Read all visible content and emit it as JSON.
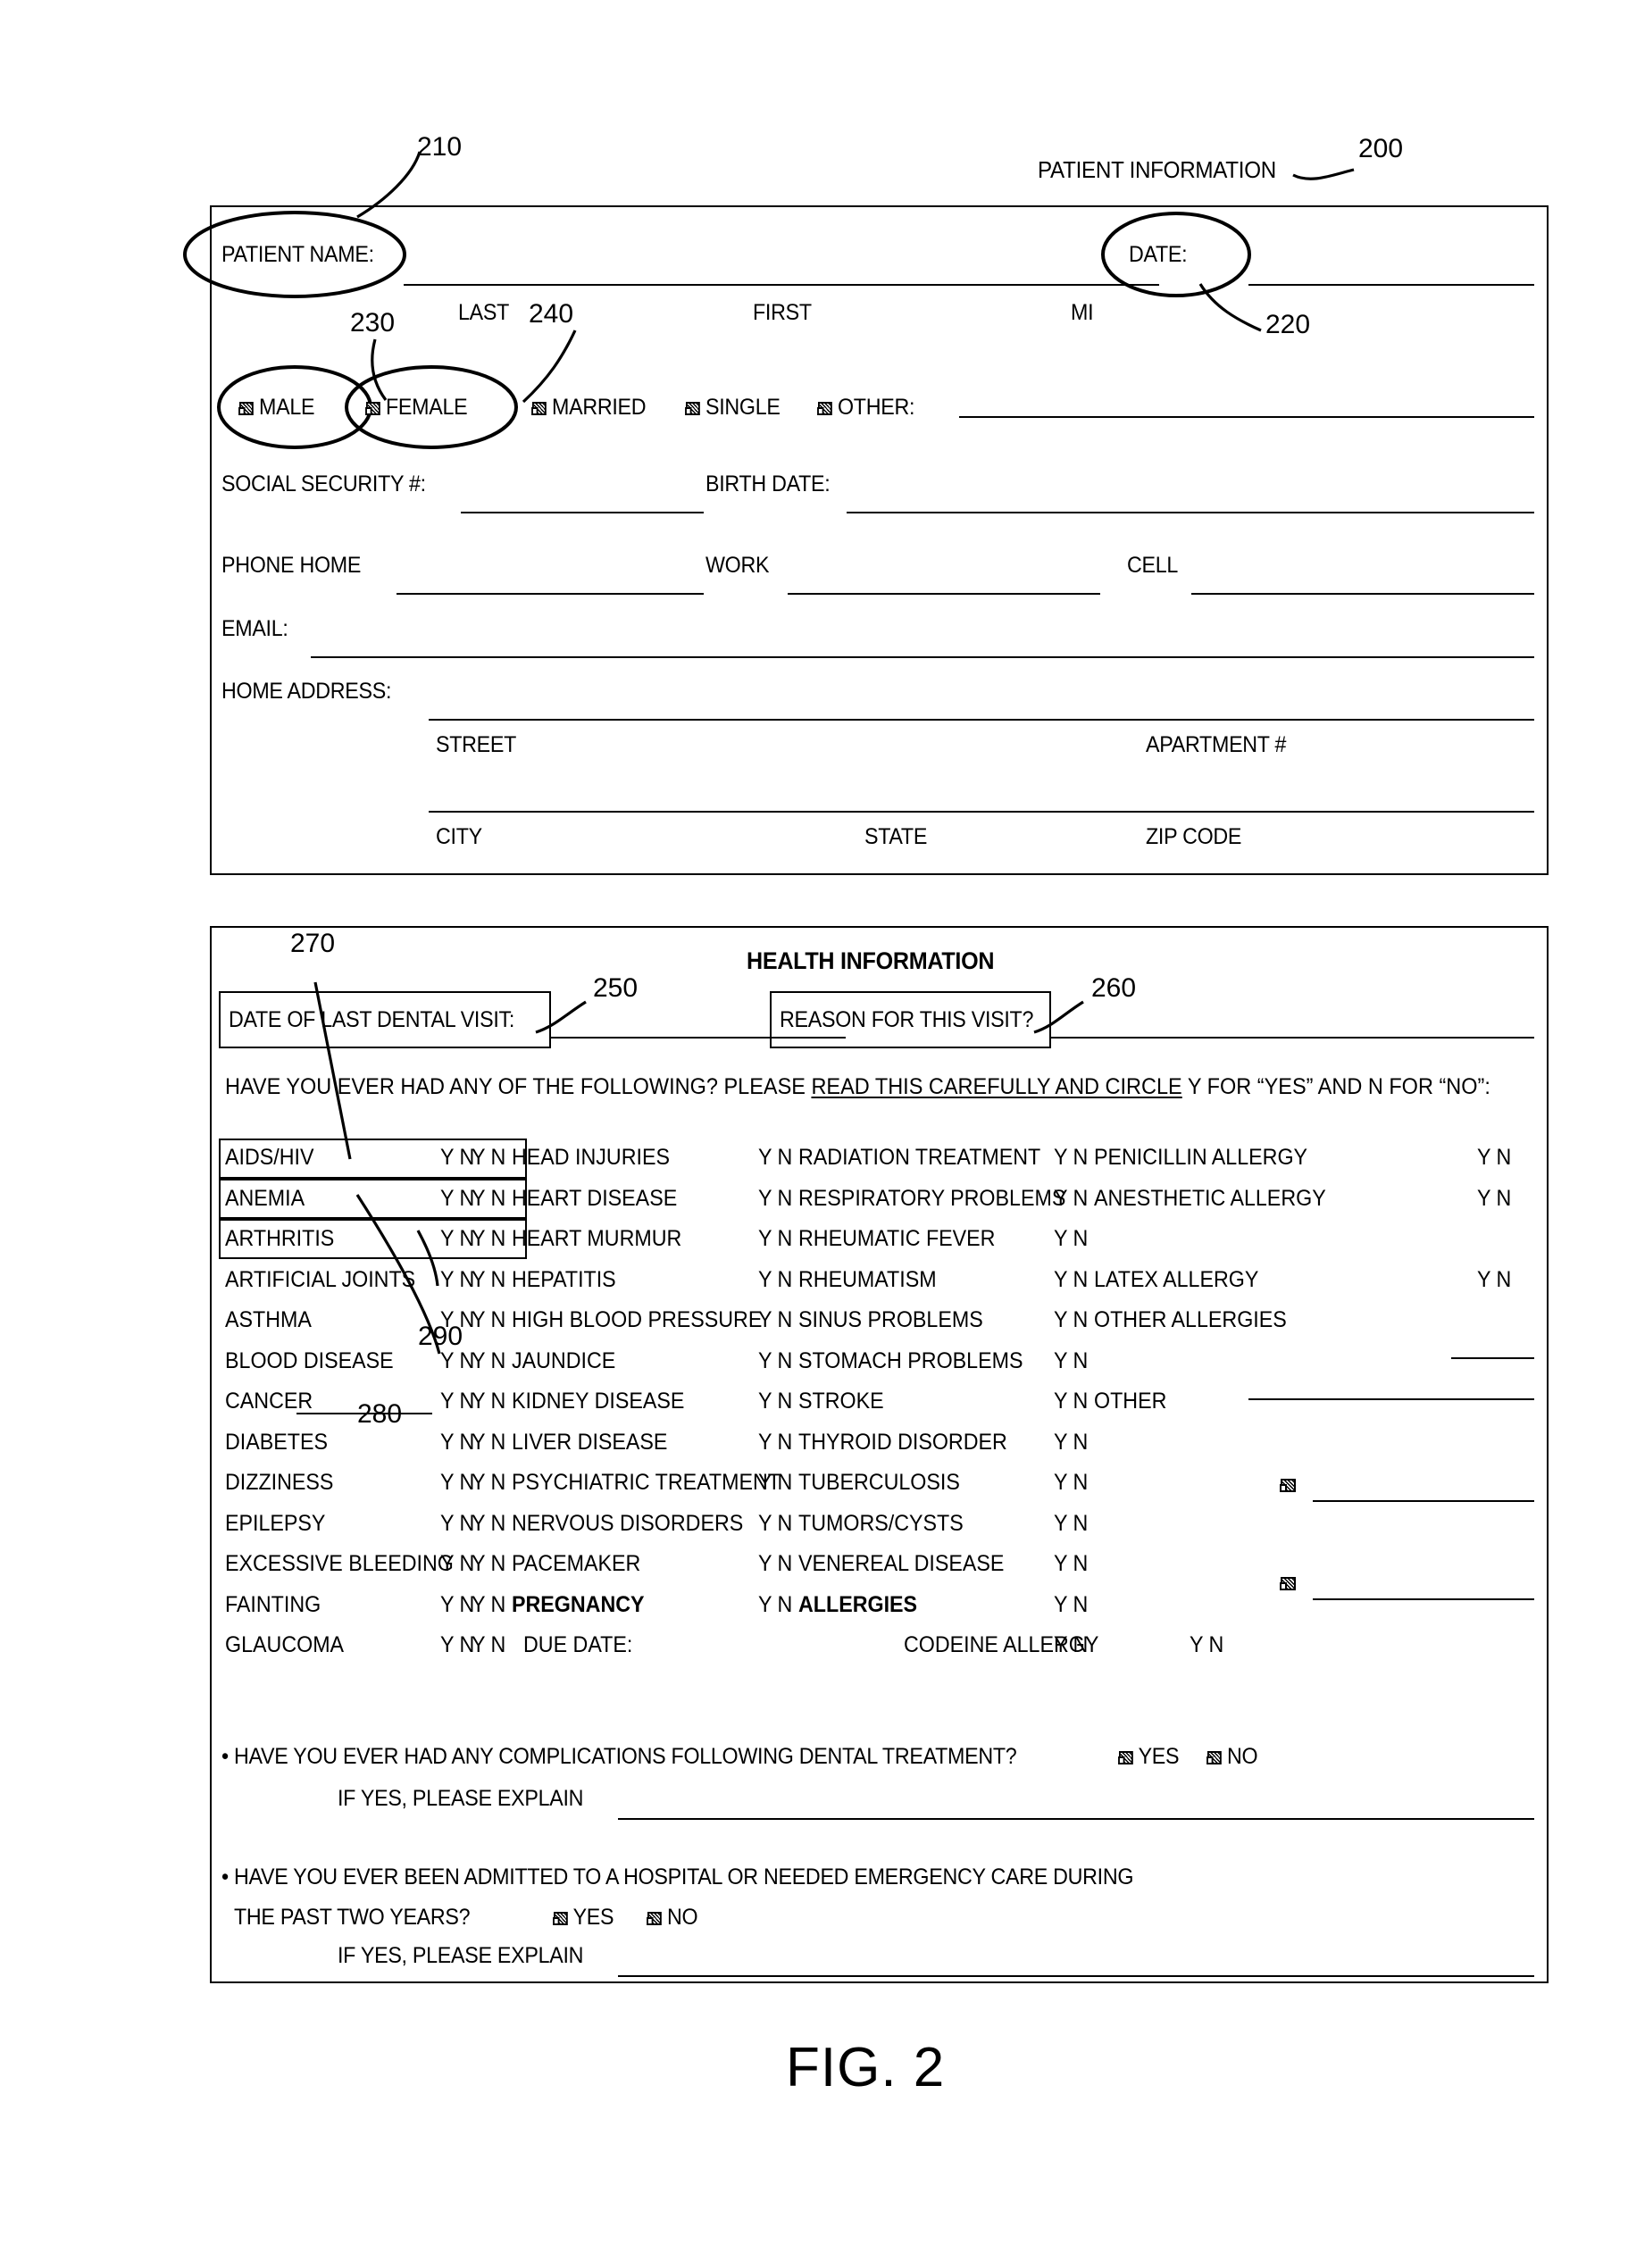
{
  "figure": {
    "caption": "FIG. 2"
  },
  "refs": {
    "r200": "200",
    "r210": "210",
    "r220": "220",
    "r230": "230",
    "r240": "240",
    "r250": "250",
    "r260": "260",
    "r270": "270",
    "r280": "280",
    "r290": "290"
  },
  "patient_section": {
    "title": "PATIENT INFORMATION",
    "name_label": "PATIENT NAME:",
    "date_label": "DATE:",
    "name_sublabels": {
      "last": "LAST",
      "first": "FIRST",
      "mi": "MI"
    },
    "gender": {
      "male": "MALE",
      "female": "FEMALE"
    },
    "marital": {
      "married": "MARRIED",
      "single": "SINGLE",
      "other": "OTHER:"
    },
    "ssn_label": "SOCIAL SECURITY #:",
    "birthdate_label": "BIRTH DATE:",
    "phone_home_label": "PHONE HOME",
    "work_label": "WORK",
    "cell_label": "CELL",
    "email_label": "EMAIL:",
    "home_address_label": "HOME ADDRESS:",
    "street_label": "STREET",
    "apartment_label": "APARTMENT #",
    "city_label": "CITY",
    "state_label": "STATE",
    "zip_label": "ZIP CODE"
  },
  "health_section": {
    "title": "HEALTH INFORMATION",
    "last_visit_label": "DATE OF LAST DENTAL VISIT:",
    "reason_label": "REASON FOR THIS VISIT?",
    "instruction": {
      "part1": "HAVE YOU EVER HAD ANY OF THE FOLLOWING? PLEASE ",
      "underlined": "READ THIS CAREFULLY AND CIRCLE",
      "part2": " Y FOR “YES” AND N FOR “NO”:"
    },
    "yes_token": "Y",
    "no_token": "N",
    "yn": "Y N",
    "column1": [
      "AIDS/HIV",
      "ANEMIA",
      "ARTHRITIS",
      "ARTIFICIAL JOINTS",
      "ASTHMA",
      "BLOOD DISEASE",
      "CANCER",
      "DIABETES",
      "DIZZINESS",
      "EPILEPSY",
      "EXCESSIVE BLEEDING",
      "FAINTING",
      "GLAUCOMA"
    ],
    "column2": [
      "HEAD INJURIES",
      "HEART DISEASE",
      "HEART MURMUR",
      "HEPATITIS",
      "HIGH BLOOD PRESSURE",
      "JAUNDICE",
      "KIDNEY DISEASE",
      "LIVER DISEASE",
      "PSYCHIATRIC TREATMENT",
      "NERVOUS DISORDERS",
      "PACEMAKER",
      "PREGNANCY",
      "DUE DATE:"
    ],
    "column3": [
      "RADIATION TREATMENT",
      "RESPIRATORY PROBLEMS",
      "RHEUMATIC FEVER",
      "RHEUMATISM",
      "SINUS PROBLEMS",
      "STOMACH PROBLEMS",
      "STROKE",
      "THYROID DISORDER",
      "TUBERCULOSIS",
      "TUMORS/CYSTS",
      "VENEREAL DISEASE",
      "ALLERGIES",
      "CODEINE ALLERGY"
    ],
    "column4": [
      "PENICILLIN ALLERGY",
      "ANESTHETIC ALLERGY",
      "",
      "LATEX ALLERGY",
      "OTHER ALLERGIES",
      "",
      "OTHER",
      "",
      "",
      "",
      "",
      "",
      ""
    ],
    "question1": {
      "bullet": "•",
      "text": "HAVE YOU EVER HAD ANY COMPLICATIONS FOLLOWING DENTAL TREATMENT?",
      "yes": "YES",
      "no": "NO",
      "explain": "IF YES, PLEASE EXPLAIN"
    },
    "question2": {
      "bullet": "•",
      "line1": "HAVE YOU EVER BEEN ADMITTED TO A HOSPITAL OR NEEDED EMERGENCY CARE DURING",
      "line2": "THE PAST TWO YEARS?",
      "yes": "YES",
      "no": "NO",
      "explain": "IF YES, PLEASE EXPLAIN"
    }
  },
  "colors": {
    "ink": "#000000",
    "paper": "#ffffff"
  }
}
